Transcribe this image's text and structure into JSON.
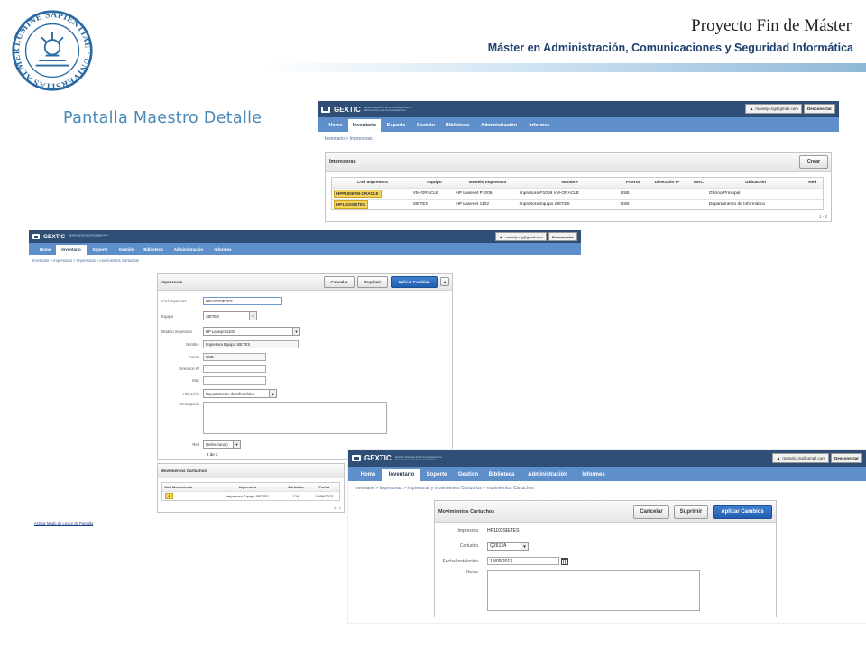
{
  "slide": {
    "title": "Proyecto Fin de Máster",
    "subtitle": "Máster en Administración, Comunicaciones y Seguridad Informática",
    "caption": "Pantalla Maestro Detalle",
    "seal_text": "LUMINE SAPIENTIAE UNIVERSITAS ALMERIENSIS"
  },
  "app": {
    "logo": "GEXTIC",
    "logo_sub": "Gestión Express de la Tecnología de la Información y las Comunicaciones",
    "user": "mararijo.rig@gmail.com",
    "logout": "Desconectar",
    "tabs": [
      "Home",
      "Inventario",
      "Soporte",
      "Gestión",
      "Biblioteca",
      "Administración",
      "Informes"
    ],
    "active_tab": "Inventario"
  },
  "screen1": {
    "breadcrumb": "Inventario > Impresoras",
    "panel_title": "Impresoras",
    "create_button": "Crear",
    "columns": [
      "Cod Impresora",
      "Equipo",
      "Modelo Impresora",
      "Nombre",
      "Puerto",
      "Dirección IP",
      "MAC",
      "Ubicación",
      "Red"
    ],
    "rows": [
      [
        "HPP1006VM-ORACLE",
        "VM-ORACLE",
        "HP Laserjet P1006",
        "Impresora P1006 VM-ORACLE",
        "USB",
        "",
        "",
        "Oficina Principal",
        ""
      ],
      [
        "HP1102SIETES",
        "SIETES",
        "HP Laserjet 1102",
        "Impresora Equipo SIETES",
        "USB",
        "",
        "",
        "Departamento de Informática",
        ""
      ]
    ],
    "pager": "1 - 2"
  },
  "screen2": {
    "breadcrumb": "Inventario > Impresoras > Impresoras y movimientos Cartuchos",
    "panel_title": "Impresoras",
    "buttons": {
      "cancel": "Cancelar",
      "delete": "Suprimir",
      "apply": "Aplicar Cambios"
    },
    "fields": {
      "cod_label": "Cod Impresora",
      "cod_value": "HP1102SIETES",
      "equipo_label": "Equipo",
      "equipo_value": "SIETES",
      "modelo_label": "Modelo Impresora",
      "modelo_value": "HP Laserjet 1102",
      "nombre_label": "Nombre",
      "nombre_value": "Impresora Equipo SIETES",
      "puerto_label": "Puerto",
      "puerto_value": "USB",
      "ip_label": "Dirección IP",
      "ip_value": "",
      "mac_label": "Mac",
      "mac_value": "",
      "ubicacion_label": "Ubicación",
      "ubicacion_value": "Departamento de Informática",
      "descripcion_label": "Descripción",
      "red_label": "Red",
      "red_value": "(Seleccionar)"
    },
    "record_counter": "2 de 2",
    "detail_title": "Movimientos Cartuchos",
    "detail_columns": [
      "Cod Movimiento",
      "Impresora",
      "Cartucho",
      "Fecha"
    ],
    "detail_rows": [
      [
        "A",
        "Impresora Equipo SIETES",
        "12A",
        "19/09/2013"
      ]
    ],
    "detail_pager": "1 - 1",
    "footer_link": "Activar Modo de Lector de Pantalla"
  },
  "screen3": {
    "breadcrumb": "Inventario > Impresoras > Impresoras y movimientos Cartuchos > movimientos Cartuchos",
    "panel_title": "Movimientos Cartuchos",
    "buttons": {
      "cancel": "Cancelar",
      "delete": "Suprimir",
      "apply": "Aplicar Cambios"
    },
    "fields": {
      "impresora_label": "Impresora",
      "impresora_value": "HP1102SIETES",
      "cartucho_label": "Cartucho",
      "cartucho_value": "Q2612A",
      "fecha_label": "Fecha Instalación",
      "fecha_value": "19/09/2013",
      "notas_label": "Notas"
    }
  }
}
